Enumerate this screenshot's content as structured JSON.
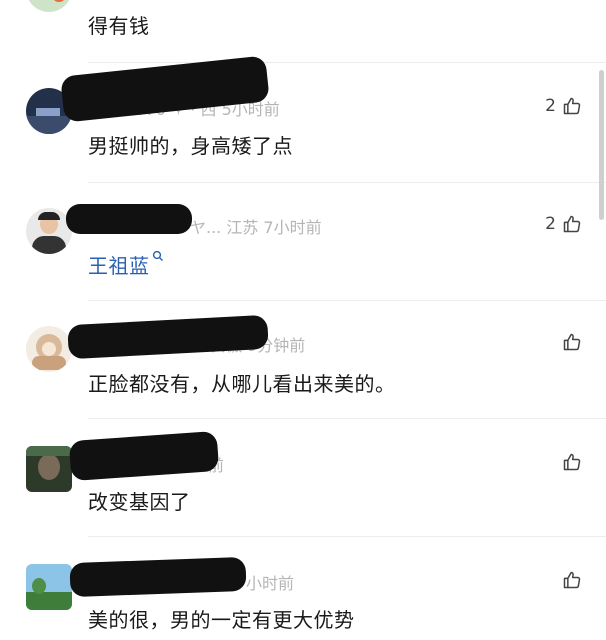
{
  "top_comment": {
    "text": "得有钱"
  },
  "comments": [
    {
      "meta": "子群 5570 ⚘ · 西 5小时前",
      "text": "男挺帅的，身高矮了点",
      "likes": "2"
    },
    {
      "meta": "ヤ... 江苏 7小时前",
      "text": "王祖蓝",
      "likes": "2"
    },
    {
      "meta": "安徽 9分钟前",
      "text": "正脸都没有，从哪儿看出来美的。",
      "likes": ""
    },
    {
      "meta": "前",
      "text": "改变基因了",
      "likes": ""
    },
    {
      "meta": "小时前",
      "text": "美的很，男的一定有更大优势",
      "likes": ""
    }
  ],
  "icons": {
    "like": "thumbs-up-icon",
    "search": "search-icon"
  },
  "colors": {
    "link": "#2b5fb3",
    "meta": "#b5b5b5",
    "text": "#1a1a1a"
  }
}
